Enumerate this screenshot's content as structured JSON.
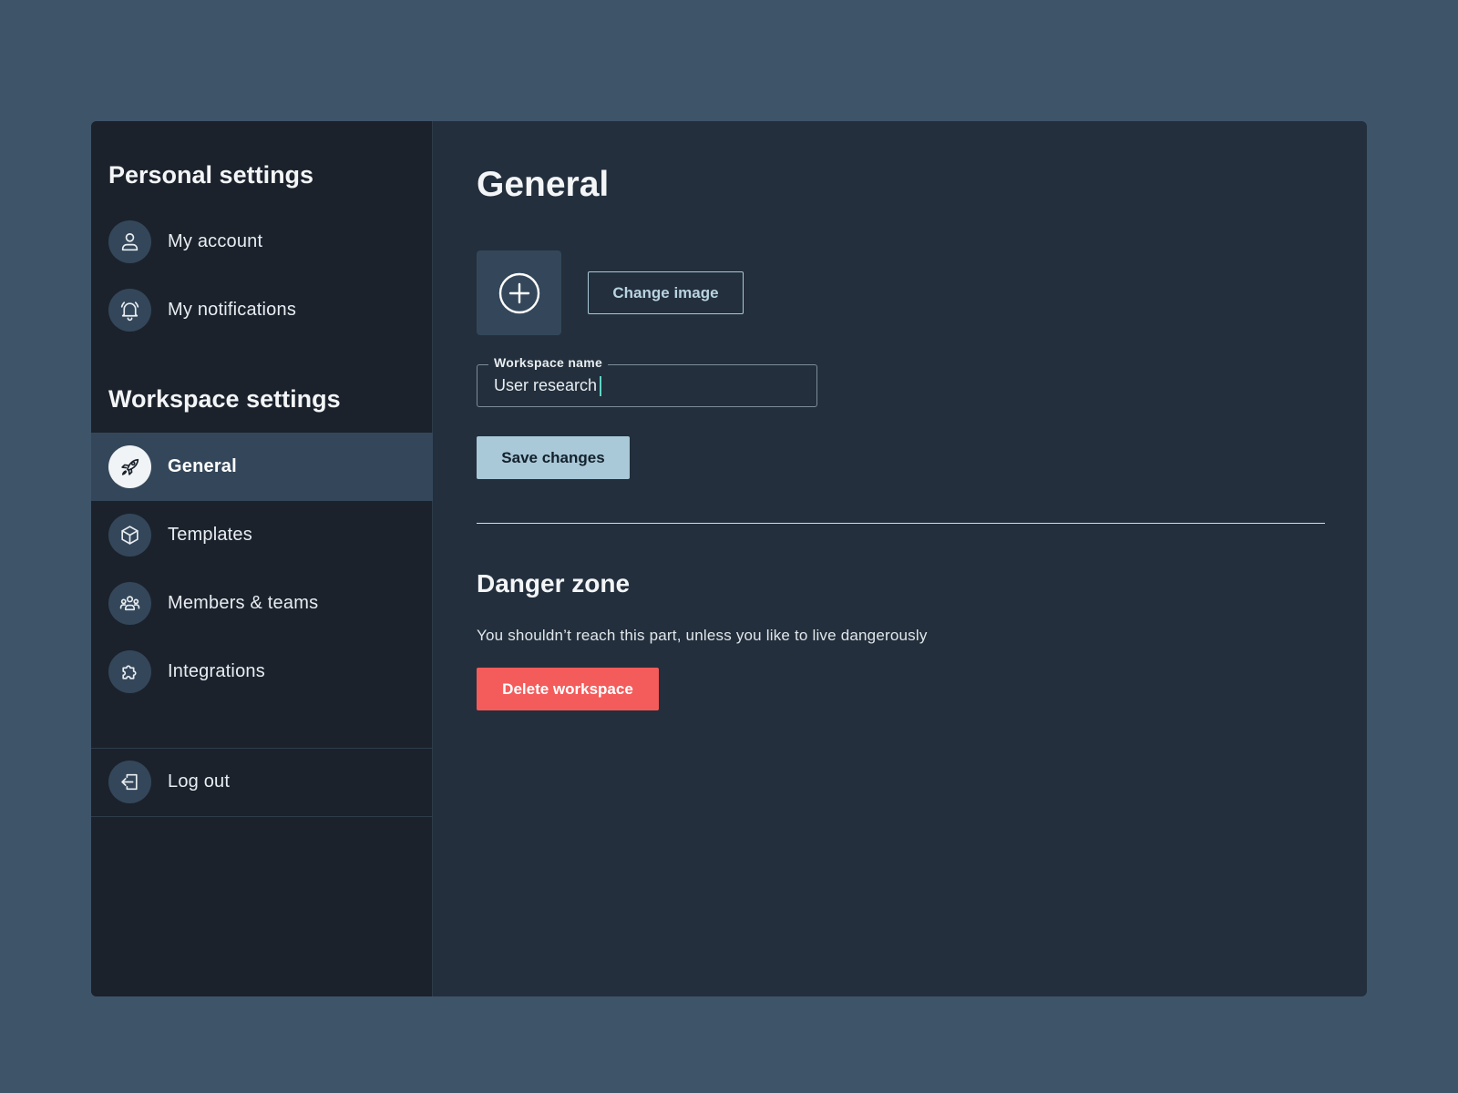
{
  "sidebar": {
    "personal_title": "Personal settings",
    "personal_items": [
      {
        "label": "My account",
        "icon": "user-icon"
      },
      {
        "label": "My notifications",
        "icon": "bell-icon"
      }
    ],
    "workspace_title": "Workspace settings",
    "workspace_items": [
      {
        "label": "General",
        "icon": "rocket-icon",
        "active": true
      },
      {
        "label": "Templates",
        "icon": "cube-icon"
      },
      {
        "label": "Members & teams",
        "icon": "users-icon"
      },
      {
        "label": "Integrations",
        "icon": "puzzle-icon"
      }
    ],
    "logout": {
      "label": "Log out",
      "icon": "logout-icon"
    }
  },
  "main": {
    "title": "General",
    "image": {
      "icon": "plus-circle-icon",
      "change_label": "Change image"
    },
    "workspace_name": {
      "label": "Workspace name",
      "value": "User research"
    },
    "save_label": "Save changes",
    "danger": {
      "title": "Danger zone",
      "text": "You shouldn’t reach this part, unless you like to live dangerously",
      "delete_label": "Delete workspace"
    }
  },
  "colors": {
    "page_background": "#3e5469",
    "sidebar_background": "#1b222c",
    "main_background": "#232f3c",
    "active_item": "#34475a",
    "primary_button": "#a9c8d8",
    "danger_button": "#f45b5b",
    "caret": "#5fd4c6"
  }
}
